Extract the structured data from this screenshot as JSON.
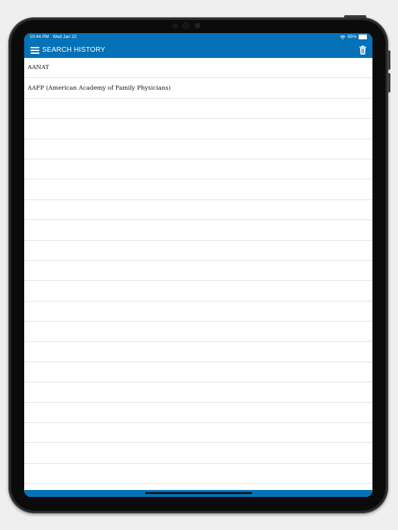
{
  "status_bar": {
    "time": "10:44 PM",
    "date": "Wed Jan 22",
    "battery_percent": "95%",
    "battery_level": 0.95,
    "wifi_icon": "wifi-icon"
  },
  "header": {
    "title": "SEARCH HISTORY",
    "menu_icon": "hamburger-menu-icon",
    "trash_icon": "trash-icon"
  },
  "history": {
    "items": [
      "AANAT",
      "AAFP (American Academy of Family Physicians)"
    ],
    "empty_rows": 19
  },
  "colors": {
    "accent": "#0572b8",
    "background": "#ffffff",
    "divider": "#e3e3e3"
  }
}
